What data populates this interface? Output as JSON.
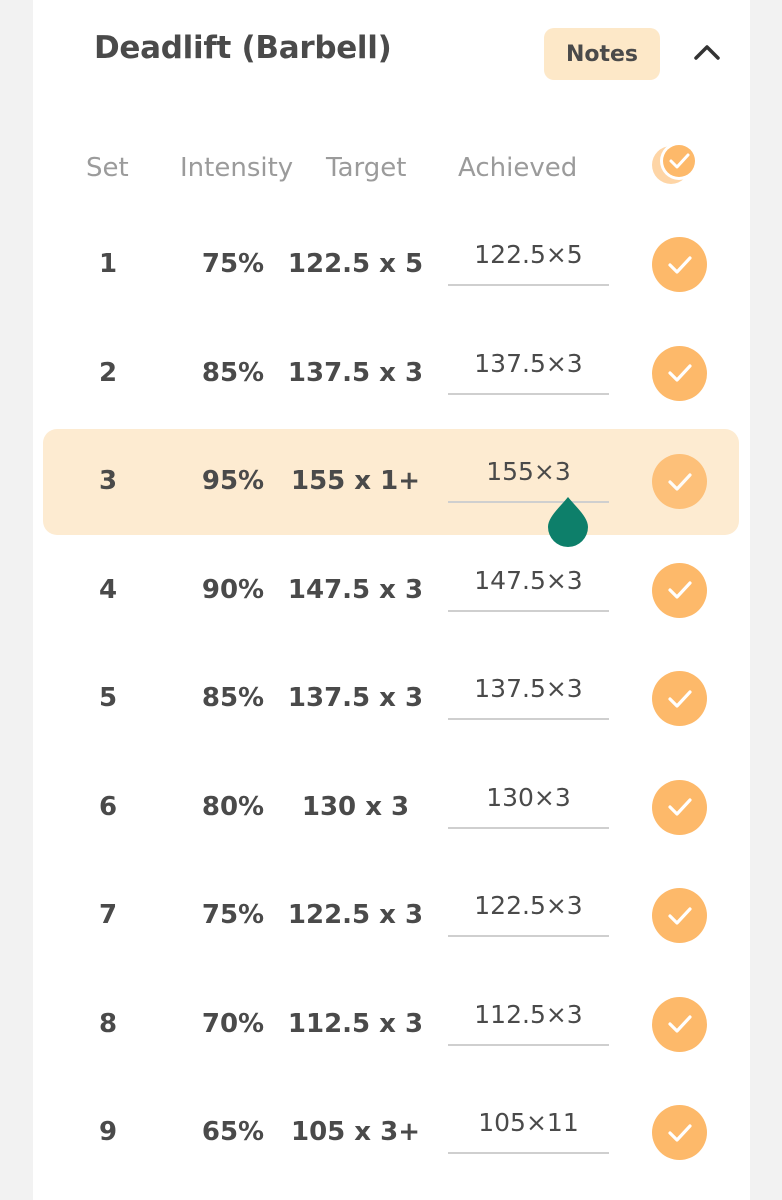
{
  "exercise": {
    "title": "Deadlift (Barbell)",
    "notes_label": "Notes",
    "collapse_icon": "chevron-up-icon"
  },
  "columns": {
    "set": "Set",
    "intensity": "Intensity",
    "target": "Target",
    "achieved": "Achieved",
    "complete_all_icon": "check-all-icon"
  },
  "sets": [
    {
      "set": "1",
      "intensity": "75%",
      "target": "122.5 x 5",
      "achieved": "122.5×5",
      "done": true
    },
    {
      "set": "2",
      "intensity": "85%",
      "target": "137.5 x 3",
      "achieved": "137.5×3",
      "done": true
    },
    {
      "set": "3",
      "intensity": "95%",
      "target": "155 x 1+",
      "achieved": "155×3",
      "done": true
    },
    {
      "set": "4",
      "intensity": "90%",
      "target": "147.5 x 3",
      "achieved": "147.5×3",
      "done": true
    },
    {
      "set": "5",
      "intensity": "85%",
      "target": "137.5 x 3",
      "achieved": "137.5×3",
      "done": true
    },
    {
      "set": "6",
      "intensity": "80%",
      "target": "130 x 3",
      "achieved": "130×3",
      "done": true
    },
    {
      "set": "7",
      "intensity": "75%",
      "target": "122.5 x 3",
      "achieved": "122.5×3",
      "done": true
    },
    {
      "set": "8",
      "intensity": "70%",
      "target": "112.5 x 3",
      "achieved": "112.5×3",
      "done": true
    },
    {
      "set": "9",
      "intensity": "65%",
      "target": "105 x 3+",
      "achieved": "105×11",
      "done": true
    }
  ],
  "active_set": "3",
  "colors": {
    "accent": "#fdb96a",
    "highlight": "#fdebd1",
    "notes_bg": "#fde8c8",
    "cursor_handle": "#0d7f6a",
    "text": "#4a4a4a",
    "muted": "#9b9b9b"
  }
}
